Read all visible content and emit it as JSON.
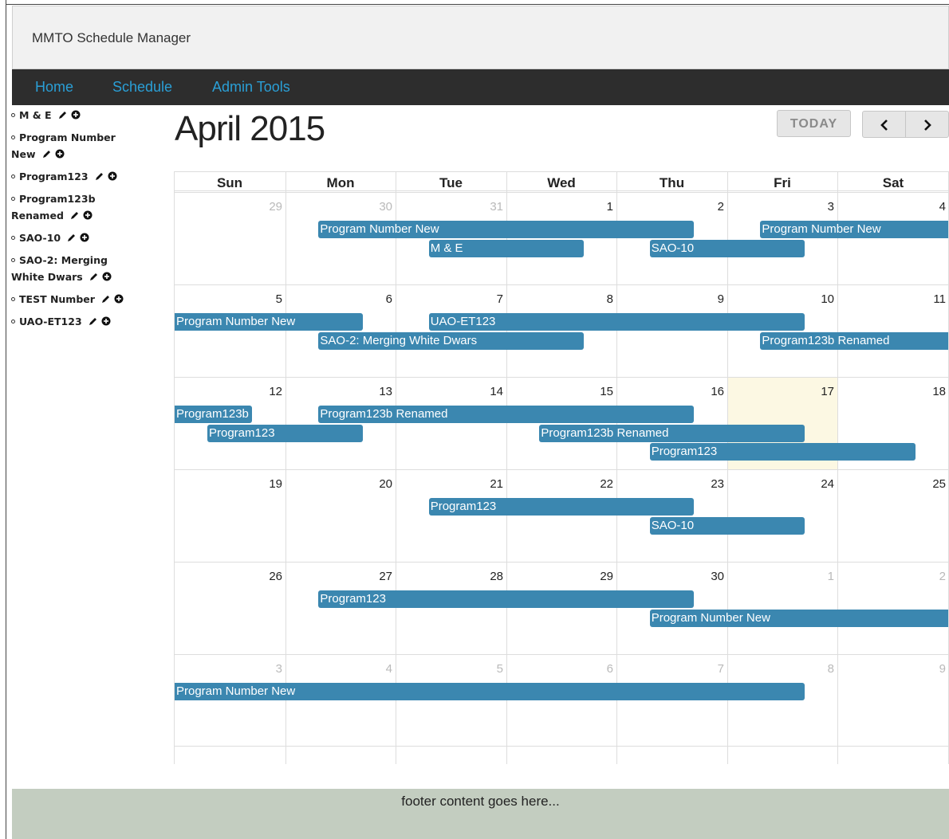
{
  "app": {
    "title": "MMTO Schedule Manager"
  },
  "nav": {
    "items": [
      "Home",
      "Schedule",
      "Admin Tools"
    ]
  },
  "sidebar": {
    "items": [
      {
        "label": "M & E"
      },
      {
        "label": "Program Number New"
      },
      {
        "label": "Program123"
      },
      {
        "label": "Program123b Renamed"
      },
      {
        "label": "SAO-10"
      },
      {
        "label": "SAO-2: Merging White Dwars"
      },
      {
        "label": "TEST Number"
      },
      {
        "label": "UAO-ET123"
      }
    ]
  },
  "calendar": {
    "title": "April 2015",
    "today_label": "TODAY",
    "prev_icon": "chevron-left-icon",
    "next_icon": "chevron-right-icon",
    "weekdays": [
      "Sun",
      "Mon",
      "Tue",
      "Wed",
      "Thu",
      "Fri",
      "Sat"
    ],
    "weeks": [
      [
        {
          "d": "29",
          "other": true
        },
        {
          "d": "30",
          "other": true
        },
        {
          "d": "31",
          "other": true
        },
        {
          "d": "1"
        },
        {
          "d": "2"
        },
        {
          "d": "3"
        },
        {
          "d": "4"
        }
      ],
      [
        {
          "d": "5"
        },
        {
          "d": "6"
        },
        {
          "d": "7"
        },
        {
          "d": "8"
        },
        {
          "d": "9"
        },
        {
          "d": "10"
        },
        {
          "d": "11"
        }
      ],
      [
        {
          "d": "12"
        },
        {
          "d": "13"
        },
        {
          "d": "14"
        },
        {
          "d": "15"
        },
        {
          "d": "16"
        },
        {
          "d": "17",
          "today": true
        },
        {
          "d": "18"
        }
      ],
      [
        {
          "d": "19"
        },
        {
          "d": "20"
        },
        {
          "d": "21"
        },
        {
          "d": "22"
        },
        {
          "d": "23"
        },
        {
          "d": "24"
        },
        {
          "d": "25"
        }
      ],
      [
        {
          "d": "26"
        },
        {
          "d": "27"
        },
        {
          "d": "28"
        },
        {
          "d": "29"
        },
        {
          "d": "30"
        },
        {
          "d": "1",
          "other": true
        },
        {
          "d": "2",
          "other": true
        }
      ],
      [
        {
          "d": "3",
          "other": true
        },
        {
          "d": "4",
          "other": true
        },
        {
          "d": "5",
          "other": true
        },
        {
          "d": "6",
          "other": true
        },
        {
          "d": "7",
          "other": true
        },
        {
          "d": "8",
          "other": true
        },
        {
          "d": "9",
          "other": true
        }
      ]
    ],
    "events": [
      {
        "title": "Program Number New",
        "week": 0,
        "start": 1.3,
        "end": 4.7,
        "row": 0
      },
      {
        "title": "Program Number New",
        "week": 0,
        "start": 5.3,
        "end": 7,
        "row": 0,
        "continues": true
      },
      {
        "title": "M & E",
        "week": 0,
        "start": 2.3,
        "end": 3.7,
        "row": 1
      },
      {
        "title": "SAO-10",
        "week": 0,
        "start": 4.3,
        "end": 5.7,
        "row": 1
      },
      {
        "title": "Program Number New",
        "week": 1,
        "start": 0,
        "end": 1.7,
        "row": 0,
        "continued": true
      },
      {
        "title": "UAO-ET123",
        "week": 1,
        "start": 2.3,
        "end": 5.7,
        "row": 0
      },
      {
        "title": "SAO-2: Merging White Dwars",
        "week": 1,
        "start": 1.3,
        "end": 3.7,
        "row": 1
      },
      {
        "title": "Program123b Renamed",
        "week": 1,
        "start": 5.3,
        "end": 7,
        "row": 1,
        "continues": true
      },
      {
        "title": "Program123b",
        "week": 2,
        "start": 0,
        "end": 0.7,
        "row": 0,
        "continued": true
      },
      {
        "title": "Program123b Renamed",
        "week": 2,
        "start": 1.3,
        "end": 4.7,
        "row": 0
      },
      {
        "title": "Program123",
        "week": 2,
        "start": 0.3,
        "end": 1.7,
        "row": 1
      },
      {
        "title": "Program123b Renamed",
        "week": 2,
        "start": 3.3,
        "end": 5.7,
        "row": 1
      },
      {
        "title": "Program123",
        "week": 2,
        "start": 4.3,
        "end": 6.7,
        "row": 2
      },
      {
        "title": "Program123",
        "week": 3,
        "start": 2.3,
        "end": 4.7,
        "row": 0
      },
      {
        "title": "SAO-10",
        "week": 3,
        "start": 4.3,
        "end": 5.7,
        "row": 1
      },
      {
        "title": "Program123",
        "week": 4,
        "start": 1.3,
        "end": 4.7,
        "row": 0
      },
      {
        "title": "Program Number New",
        "week": 4,
        "start": 4.3,
        "end": 7,
        "row": 1,
        "continues": true
      },
      {
        "title": "Program Number New",
        "week": 5,
        "start": 0,
        "end": 5.7,
        "row": 0,
        "continued": true
      }
    ]
  },
  "footer": {
    "text": "footer content goes here..."
  },
  "colors": {
    "event": "#3b87b0",
    "nav_link": "#2a9fd6",
    "today_bg": "#fcf8e3",
    "footer_bg": "#c3cdc0"
  }
}
